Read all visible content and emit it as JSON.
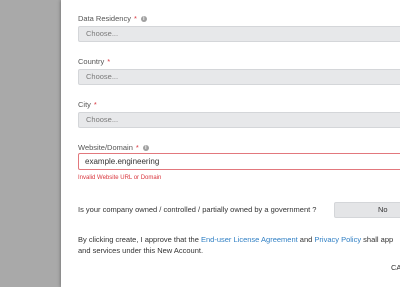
{
  "form": {
    "data_residency": {
      "label": "Data Residency",
      "required": "*",
      "placeholder": "Choose..."
    },
    "country": {
      "label": "Country",
      "required": "*",
      "placeholder": "Choose..."
    },
    "city": {
      "label": "City",
      "required": "*",
      "placeholder": "Choose..."
    },
    "website": {
      "label": "Website/Domain",
      "required": "*",
      "value": "example.engineering",
      "error": "Invalid Website URL or Domain"
    },
    "government": {
      "question": "Is your company owned / controlled / partially owned by a government ?",
      "value": "No"
    },
    "consent": {
      "prefix": "By clicking create, I approve that the ",
      "eula_link": "End-user License Agreement",
      "middle": " and ",
      "privacy_link": "Privacy Policy",
      "suffix": " shall app",
      "line2": "and services under this New Account."
    },
    "create_label": "CA"
  },
  "colors": {
    "error": "#d9363e",
    "link": "#2f7fc4",
    "overlay": "#a9a9a9"
  }
}
